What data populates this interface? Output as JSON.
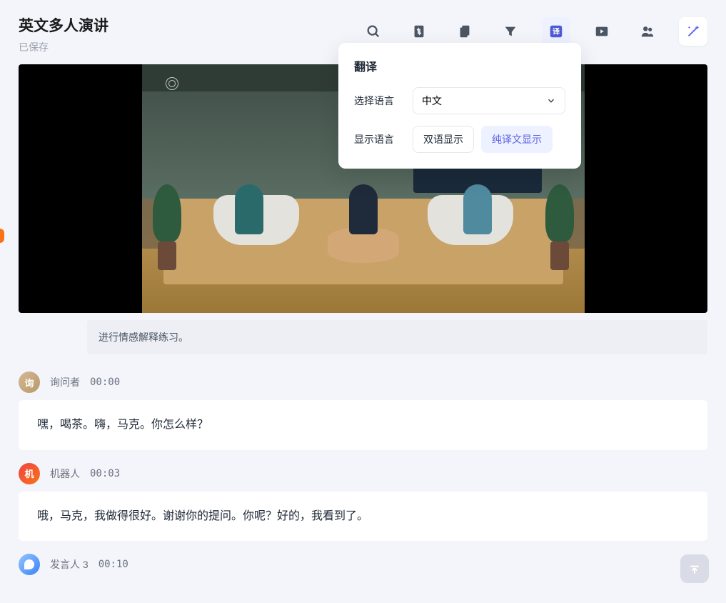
{
  "header": {
    "title": "英文多人演讲",
    "save_status": "已保存"
  },
  "toolbar": {
    "search": "search-icon",
    "swap": "swap-icon",
    "copy": "copy-icon",
    "filter": "filter-icon",
    "translate": "translate-icon",
    "video": "video-icon",
    "people": "people-icon",
    "magic": "magic-wand-icon"
  },
  "popover": {
    "title": "翻译",
    "lang_label": "选择语言",
    "lang_value": "中文",
    "display_label": "显示语言",
    "option_bilingual": "双语显示",
    "option_translation_only": "纯译文显示"
  },
  "note": "进行情感解释练习。",
  "entries": [
    {
      "avatar_char": "询",
      "speaker": "询问者",
      "time": "00:00",
      "text": "嘿，喝茶。嗨，马克。你怎么样？"
    },
    {
      "avatar_char": "机",
      "speaker": "机器人",
      "time": "00:03",
      "text": "哦，马克，我做得很好。谢谢你的提问。你呢？好的，我看到了。"
    },
    {
      "avatar_char": "",
      "speaker": "发言人 3",
      "time": "00:10",
      "text": ""
    }
  ]
}
